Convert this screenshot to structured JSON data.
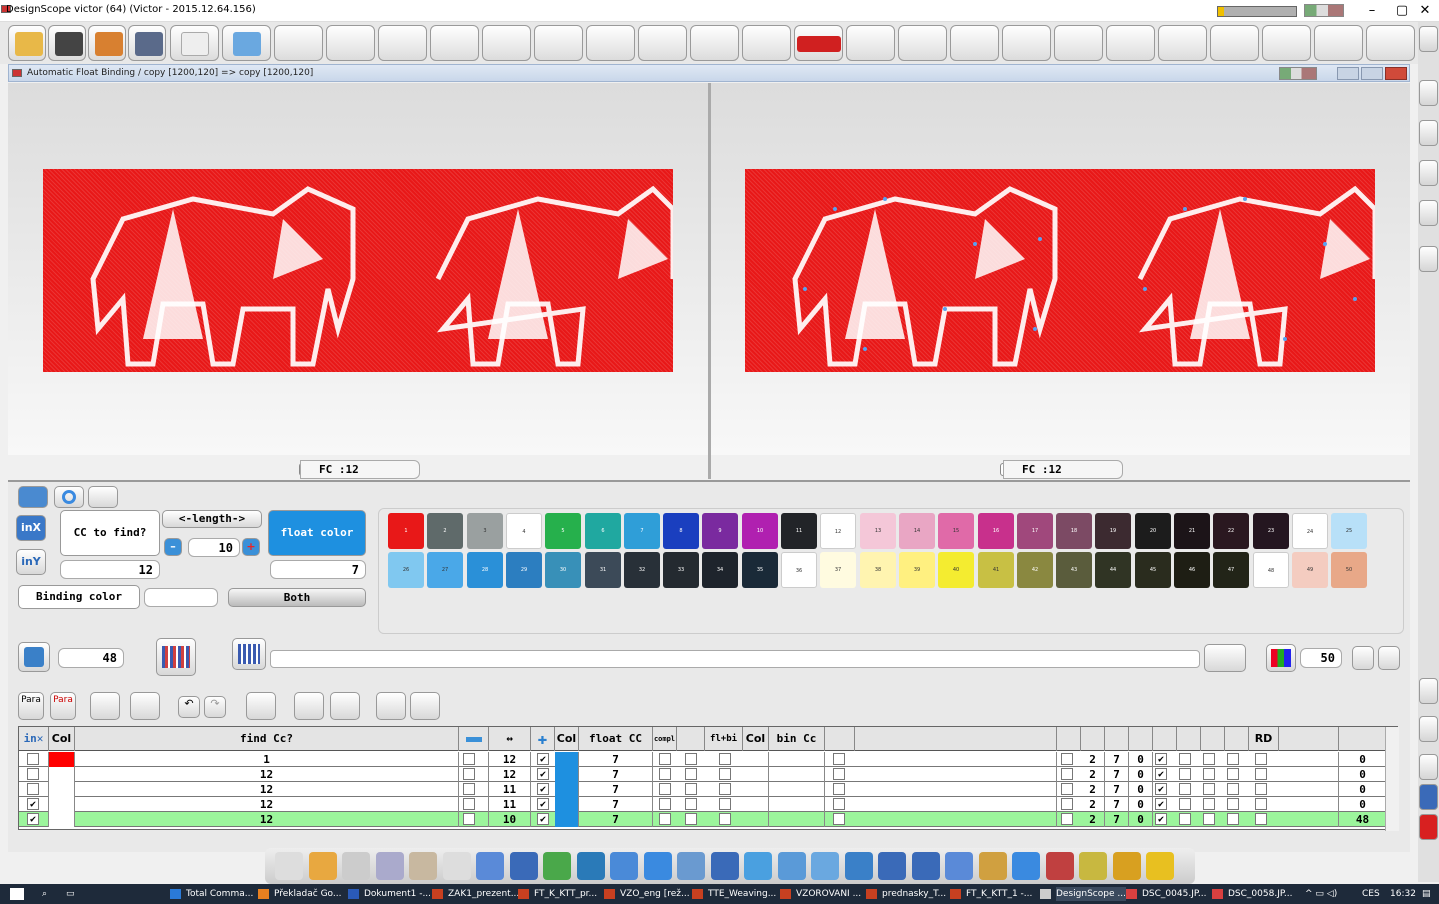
{
  "window": {
    "title": "DesignScope victor (64) (Victor - 2015.12.64.156)",
    "min": "–",
    "max": "▢",
    "close": "✕"
  },
  "subwindow": {
    "title": "Automatic Float Binding / copy [1200,120] => copy [1200,120]"
  },
  "left_panel": {
    "fc": "FC :12"
  },
  "right_panel": {
    "fc": "FC :12"
  },
  "controls": {
    "inx": "inX",
    "iny": "inY",
    "cc_to_find_label": "CC to find?",
    "cc_value": "12",
    "length_label": "<-length->",
    "length_value": "10",
    "minus": "–",
    "plus": "+",
    "float_color_label": "float color",
    "float_color_value": "7",
    "binding_color_label": "Binding color",
    "binding_color_value": "",
    "both_label": "Both",
    "count_value": "48",
    "right_value": "50",
    "para1": "Para",
    "para2": "Para"
  },
  "palette": {
    "row1": [
      "1",
      "2",
      "3",
      "4",
      "5",
      "6",
      "7",
      "8",
      "9",
      "10",
      "11",
      "12",
      "13",
      "14",
      "15",
      "16",
      "17",
      "18",
      "19",
      "20",
      "21",
      "22",
      "23",
      "24",
      "25"
    ],
    "row2": [
      "26",
      "27",
      "28",
      "29",
      "30",
      "31",
      "32",
      "33",
      "34",
      "35",
      "36",
      "37",
      "38",
      "39",
      "40",
      "41",
      "42",
      "43",
      "44",
      "45",
      "46",
      "47",
      "48",
      "49",
      "50"
    ],
    "colors1": [
      "#e81818",
      "#5f6a6a",
      "#9aa0a0",
      "#ffffff",
      "#26b04c",
      "#20a8a0",
      "#2f9ed8",
      "#1a3fbf",
      "#7a2a9f",
      "#b020b0",
      "#222428",
      "#ffffff",
      "#f4c7d8",
      "#e9a6c4",
      "#e06aa8",
      "#c8308c",
      "#a0487c",
      "#7c4a64",
      "#3c2a30",
      "#1c1c1c",
      "#1c1418",
      "#2a1820",
      "#241620",
      "#ffffff",
      "#b8e0f8"
    ],
    "colors2": [
      "#80c8f0",
      "#4aa8e8",
      "#2a90d8",
      "#2c7ec0",
      "#3890b8",
      "#3c4a58",
      "#283038",
      "#242a30",
      "#1e242c",
      "#1a2a38",
      "#ffffff",
      "#fffbe0",
      "#fff4b0",
      "#fff080",
      "#f4ec30",
      "#c8c044",
      "#8a8840",
      "#5a5c3c",
      "#303424",
      "#2a2c1e",
      "#1e1e14",
      "#222418",
      "#ffffff",
      "#f4ccc0",
      "#e8a888"
    ]
  },
  "table": {
    "headers": [
      "in✕",
      "Col",
      "find Cc?",
      "",
      "↔",
      "✚",
      "Col",
      "float CC",
      "compl",
      "",
      "fl+bi",
      "Col",
      "bin Cc",
      "",
      "",
      "",
      "",
      "",
      "",
      "",
      "",
      "",
      "",
      "",
      "",
      "",
      "RD",
      "",
      ""
    ],
    "rows": [
      {
        "in": "",
        "col": "#ff0000",
        "find": "1",
        "len": "12",
        "chk": "✔",
        "fcol": "#1e90e0",
        "float": "7",
        "a": "2",
        "b": "7",
        "c": "0",
        "d": "✔",
        "res": "0",
        "hl": false
      },
      {
        "in": "",
        "col": "#ffffff",
        "find": "12",
        "len": "12",
        "chk": "✔",
        "fcol": "#1e90e0",
        "float": "7",
        "a": "2",
        "b": "7",
        "c": "0",
        "d": "✔",
        "res": "0",
        "hl": false
      },
      {
        "in": "",
        "col": "#ffffff",
        "find": "12",
        "len": "11",
        "chk": "✔",
        "fcol": "#1e90e0",
        "float": "7",
        "a": "2",
        "b": "7",
        "c": "0",
        "d": "✔",
        "res": "0",
        "hl": false
      },
      {
        "in": "✔",
        "col": "#ffffff",
        "find": "12",
        "len": "11",
        "chk": "✔",
        "fcol": "#1e90e0",
        "float": "7",
        "a": "2",
        "b": "7",
        "c": "0",
        "d": "✔",
        "res": "0",
        "hl": false
      },
      {
        "in": "✔",
        "col": "#ffffff",
        "find": "12",
        "len": "10",
        "chk": "✔",
        "fcol": "#1e90e0",
        "float": "7",
        "a": "2",
        "b": "7",
        "c": "0",
        "d": "✔",
        "res": "48",
        "hl": true
      }
    ],
    "rd_label": "RD"
  },
  "taskbar": {
    "items": [
      "Total Comma...",
      "Překladač Go...",
      "Dokument1 -...",
      "ZAK1_prezent...",
      "FT_K_KTT_pr...",
      "VZO_eng [rež...",
      "TTE_Weaving...",
      "VZOROVANI ...",
      "prednasky_T...",
      "FT_K_KTT_1 -...",
      "DesignScope ...",
      "DSC_0045.JP...",
      "DSC_0058.JP..."
    ],
    "lang": "CES",
    "time": "16:32"
  }
}
